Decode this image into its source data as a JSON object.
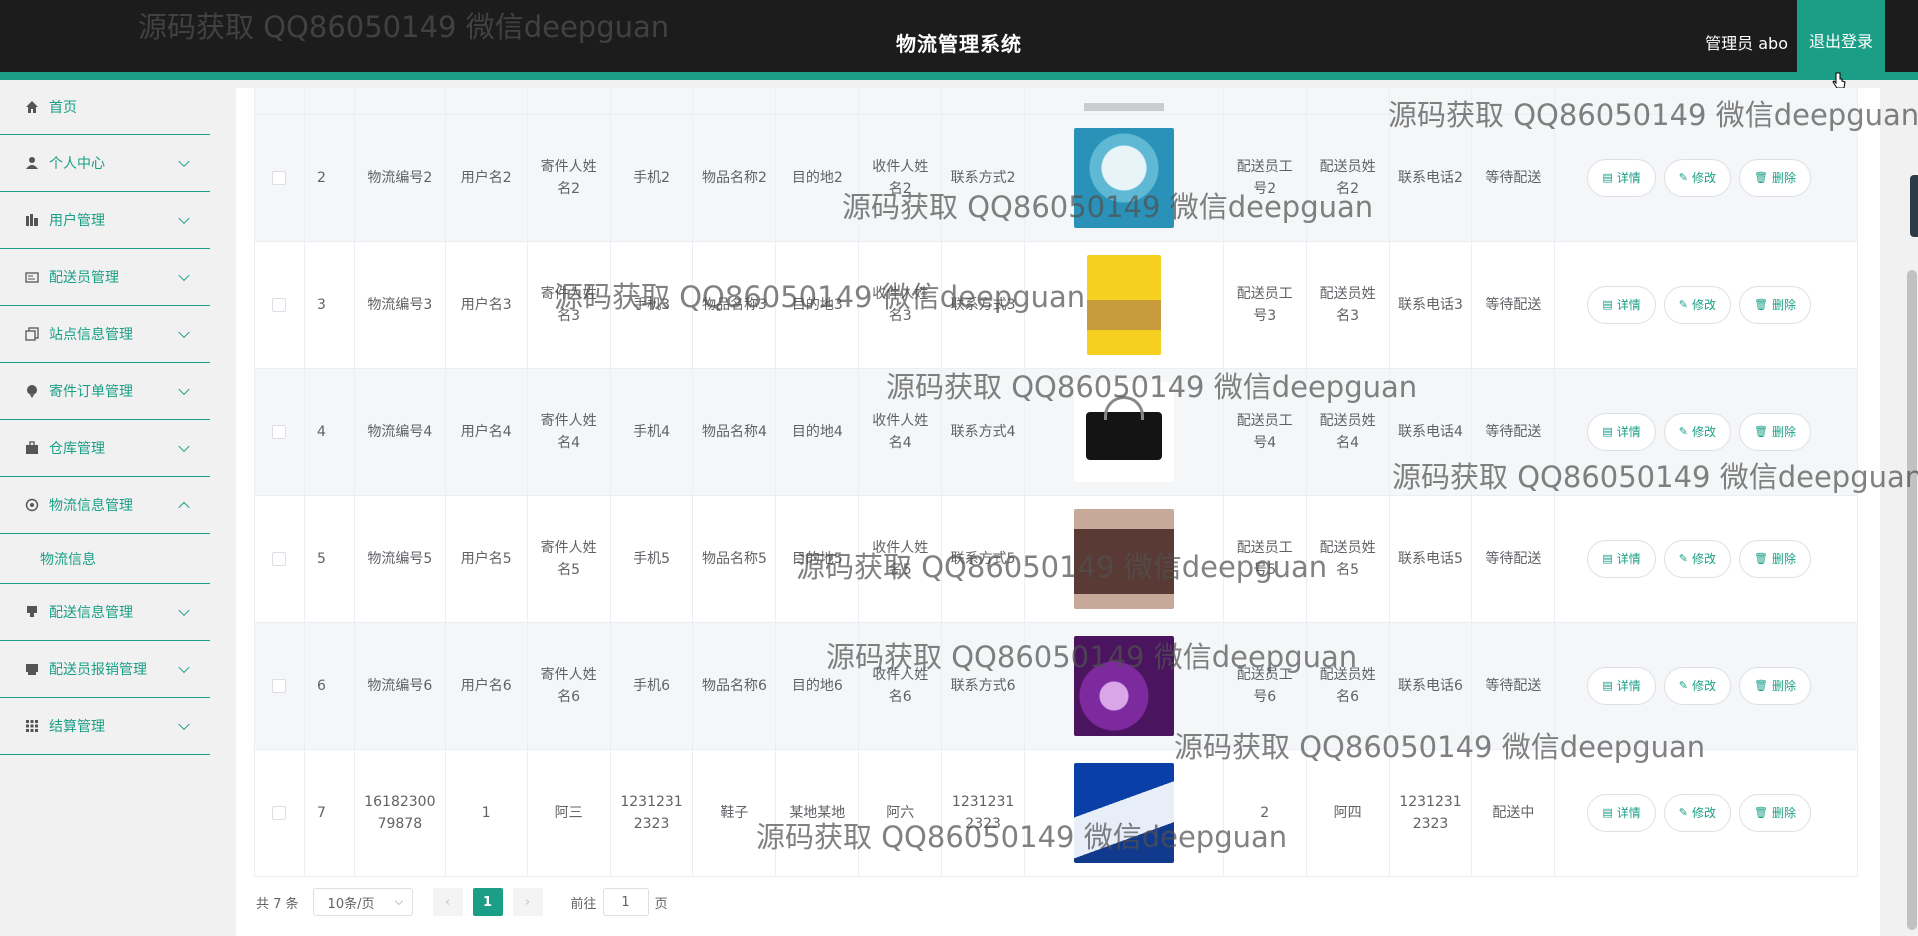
{
  "header": {
    "title": "物流管理系统",
    "admin_text": "管理员 abo",
    "logout_label": "退出登录"
  },
  "sidebar": {
    "items": [
      {
        "label": "首页",
        "icon": "home-icon"
      },
      {
        "label": "个人中心",
        "icon": "user-icon"
      },
      {
        "label": "用户管理",
        "icon": "users-icon"
      },
      {
        "label": "配送员管理",
        "icon": "id-card-icon"
      },
      {
        "label": "站点信息管理",
        "icon": "copy-icon"
      },
      {
        "label": "寄件订单管理",
        "icon": "pin-icon"
      },
      {
        "label": "仓库管理",
        "icon": "briefcase-icon"
      },
      {
        "label": "物流信息管理",
        "icon": "settings-icon",
        "expanded": true
      },
      {
        "label": "配送信息管理",
        "icon": "stamp-icon"
      },
      {
        "label": "配送员报销管理",
        "icon": "printer-icon"
      },
      {
        "label": "结算管理",
        "icon": "grid-icon"
      }
    ],
    "submenu": {
      "label": "物流信息"
    }
  },
  "table": {
    "rows": [
      {
        "idx": "2",
        "no": "物流编号2",
        "user": "用户名2",
        "sender": "寄件人姓名2",
        "phone": "手机2",
        "item": "物品名称2",
        "dest": "目的地2",
        "receiver": "收件人姓名2",
        "contact": "联系方式2",
        "image": "kettle",
        "dno": "配送员工号2",
        "dname": "配送员姓名2",
        "dtel": "联系电话2",
        "status": "等待配送"
      },
      {
        "idx": "3",
        "no": "物流编号3",
        "user": "用户名3",
        "sender": "寄件人姓名3",
        "phone": "手机3",
        "item": "物品名称3",
        "dest": "目的地3",
        "receiver": "收件人姓名3",
        "contact": "联系方式3",
        "image": "book",
        "dno": "配送员工号3",
        "dname": "配送员姓名3",
        "dtel": "联系电话3",
        "status": "等待配送"
      },
      {
        "idx": "4",
        "no": "物流编号4",
        "user": "用户名4",
        "sender": "寄件人姓名4",
        "phone": "手机4",
        "item": "物品名称4",
        "dest": "目的地4",
        "receiver": "收件人姓名4",
        "contact": "联系方式4",
        "image": "handbag",
        "dno": "配送员工号4",
        "dname": "配送员姓名4",
        "dtel": "联系电话4",
        "status": "等待配送"
      },
      {
        "idx": "5",
        "no": "物流编号5",
        "user": "用户名5",
        "sender": "寄件人姓名5",
        "phone": "手机5",
        "item": "物品名称5",
        "dest": "目的地5",
        "receiver": "收件人姓名5",
        "contact": "联系方式5",
        "image": "crossbody-bag",
        "dno": "配送员工号5",
        "dname": "配送员姓名5",
        "dtel": "联系电话5",
        "status": "等待配送"
      },
      {
        "idx": "6",
        "no": "物流编号6",
        "user": "用户名6",
        "sender": "寄件人姓名6",
        "phone": "手机6",
        "item": "物品名称6",
        "dest": "目的地6",
        "receiver": "收件人姓名6",
        "contact": "联系方式6",
        "image": "cosmetics",
        "dno": "配送员工号6",
        "dname": "配送员姓名6",
        "dtel": "联系电话6",
        "status": "等待配送"
      },
      {
        "idx": "7",
        "no": "1618230079878",
        "user": "1",
        "sender": "阿三",
        "phone": "12312312323",
        "item": "鞋子",
        "dest": "某地某地",
        "receiver": "阿六",
        "contact": "12312312323",
        "image": "sneakers",
        "dno": "2",
        "dname": "阿四",
        "dtel": "12312312323",
        "status": "配送中"
      }
    ],
    "actions": {
      "detail": "详情",
      "edit": "修改",
      "delete": "删除"
    }
  },
  "pagination": {
    "total": "共 7 条",
    "page_size": "10条/页",
    "current_page": "1",
    "goto_label": "前往",
    "goto_value": "1",
    "page_unit": "页"
  },
  "watermark": {
    "text": "源码获取 QQ86050149 微信deepguan"
  },
  "colors": {
    "accent": "#1a9f86",
    "header_bg": "#1c1c1c"
  }
}
